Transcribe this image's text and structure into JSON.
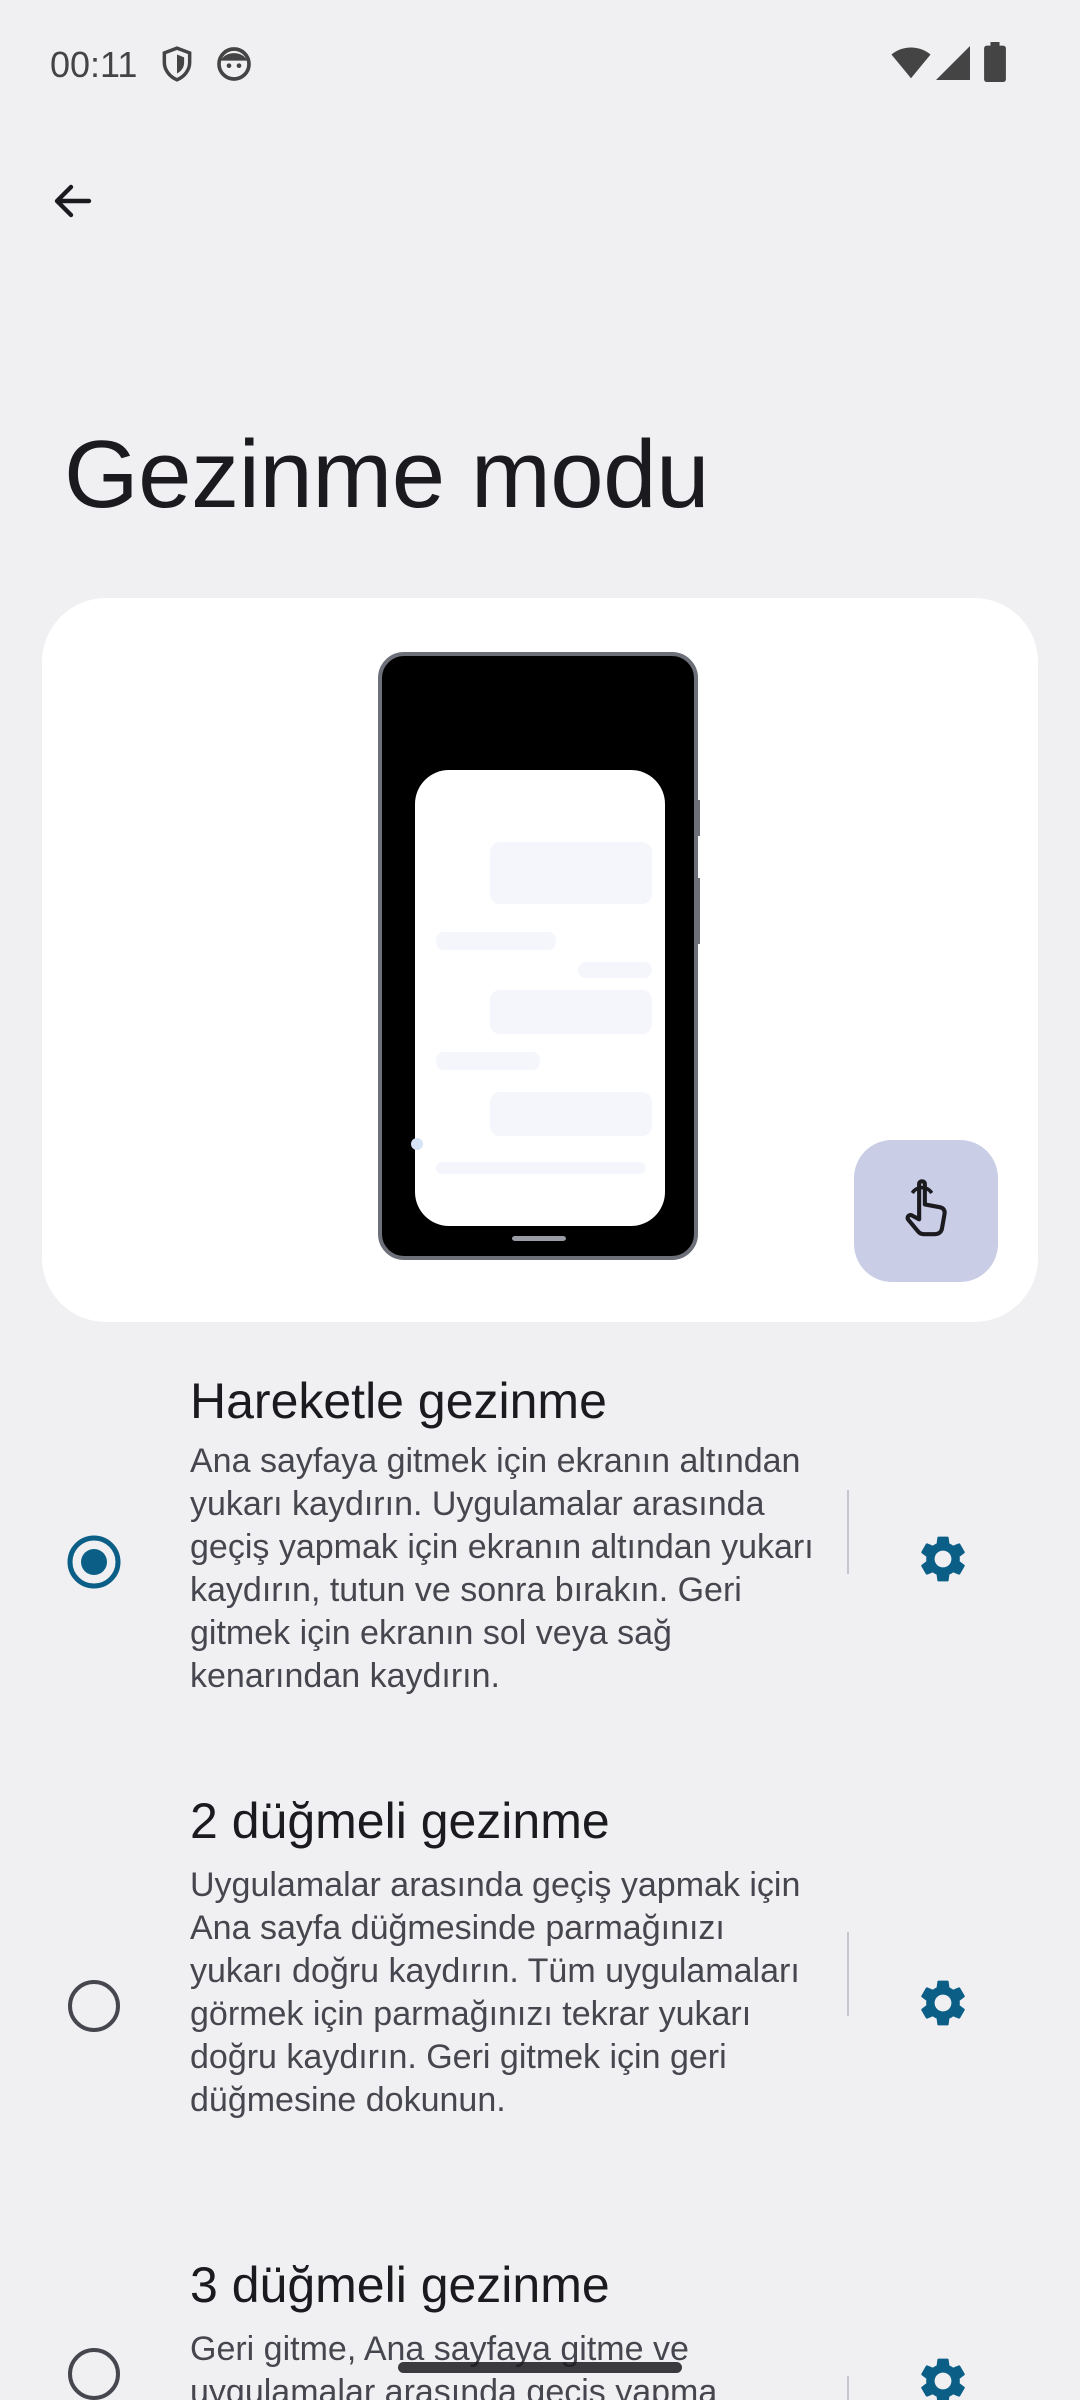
{
  "status_bar": {
    "time": "00:11",
    "left_icons": [
      "shield-icon",
      "face-icon"
    ],
    "right_icons": [
      "wifi-icon",
      "signal-icon",
      "battery-icon"
    ]
  },
  "app_bar": {
    "back_icon": "back-arrow-icon"
  },
  "page": {
    "title": "Gezinme modu"
  },
  "illustration": {
    "gesture_button_icon": "touch-hand-icon"
  },
  "options": [
    {
      "title": "Hareketle gezinme",
      "description": "Ana sayfaya gitmek için ekranın altından yukarı kaydırın. Uygulamalar arasında geçiş yapmak için ekranın altından yukarı kaydırın, tutun ve sonra bırakın. Geri gitmek için ekranın sol veya sağ kenarından kaydırın.",
      "selected": true,
      "settings_icon": "gear-icon"
    },
    {
      "title": "2 düğmeli gezinme",
      "description": "Uygulamalar arasında geçiş yapmak için Ana sayfa düğmesinde parmağınızı yukarı doğru kaydırın. Tüm uygulamaları görmek için parmağınızı tekrar yukarı doğru kaydırın. Geri gitmek için geri düğmesine dokunun.",
      "selected": false,
      "settings_icon": "gear-icon"
    },
    {
      "title": "3 düğmeli gezinme",
      "description": "Geri gitme, Ana sayfaya gitme ve uygulamalar arasında geçiş yapma",
      "selected": false,
      "settings_icon": "gear-icon"
    }
  ],
  "colors": {
    "accent": "#0b5e86",
    "background": "#f0f0f3",
    "card": "#ffffff",
    "gesture_button": "#c9cde6"
  }
}
